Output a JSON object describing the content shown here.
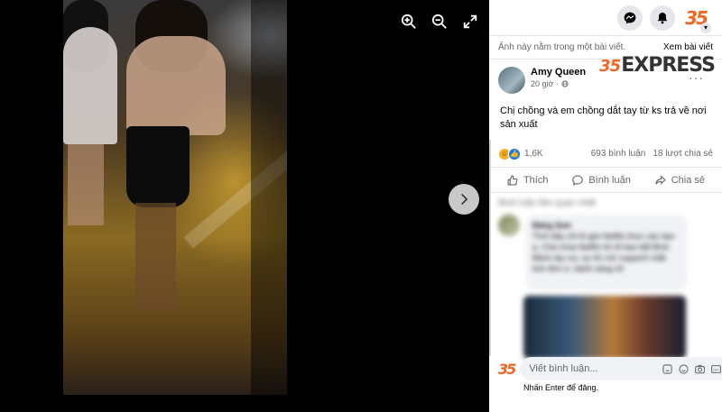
{
  "viewer": {
    "controls": {
      "zoom_in": "zoom-in-icon",
      "zoom_out": "zoom-out-icon",
      "fullscreen": "fullscreen-icon",
      "next": "chevron-right-icon"
    }
  },
  "topbar": {
    "icons": [
      "messenger-icon",
      "notifications-bell-icon",
      "account-menu-icon"
    ]
  },
  "info_bar": {
    "text": "Ảnh này nằm trong một bài viết.",
    "link": "Xem bài viết"
  },
  "post": {
    "author": "Amy Queen",
    "time": "20 giờ ·",
    "privacy_icon": "globe-icon",
    "caption": "Chị chồng và em chồng dắt tay từ ks trả về nơi sản xuất",
    "watermark": "EXPRESS",
    "reactions": {
      "count": "1,6K",
      "comments": "693 bình luận",
      "shares": "18 lượt chia sẻ"
    },
    "actions": {
      "like": "Thích",
      "comment": "Bình luận",
      "share": "Chia sẻ"
    }
  },
  "comments": {
    "sort_label": "Bình luận liên quan nhất",
    "items": [
      {
        "name": "Đăng Sơn",
        "text": "Tình tiếp chỉ tỏ gioi Netflix thực các ban ạ. Chả chúa Netflix thì đi bao bắt Bình Bảnh tay vui, sự thì mở support! miệt tinh đơn ơ, bánh sáng rồi"
      }
    ]
  },
  "composer": {
    "placeholder": "Viết bình luận...",
    "hint": "Nhấn Enter để đăng.",
    "icons": [
      "sticker-icon",
      "emoji-icon",
      "camera-icon",
      "gif-icon",
      "sticker-face-icon"
    ]
  },
  "colors": {
    "brand_orange": "#f26522",
    "facebook_blue": "#1877f2",
    "text_secondary": "#65676b"
  }
}
